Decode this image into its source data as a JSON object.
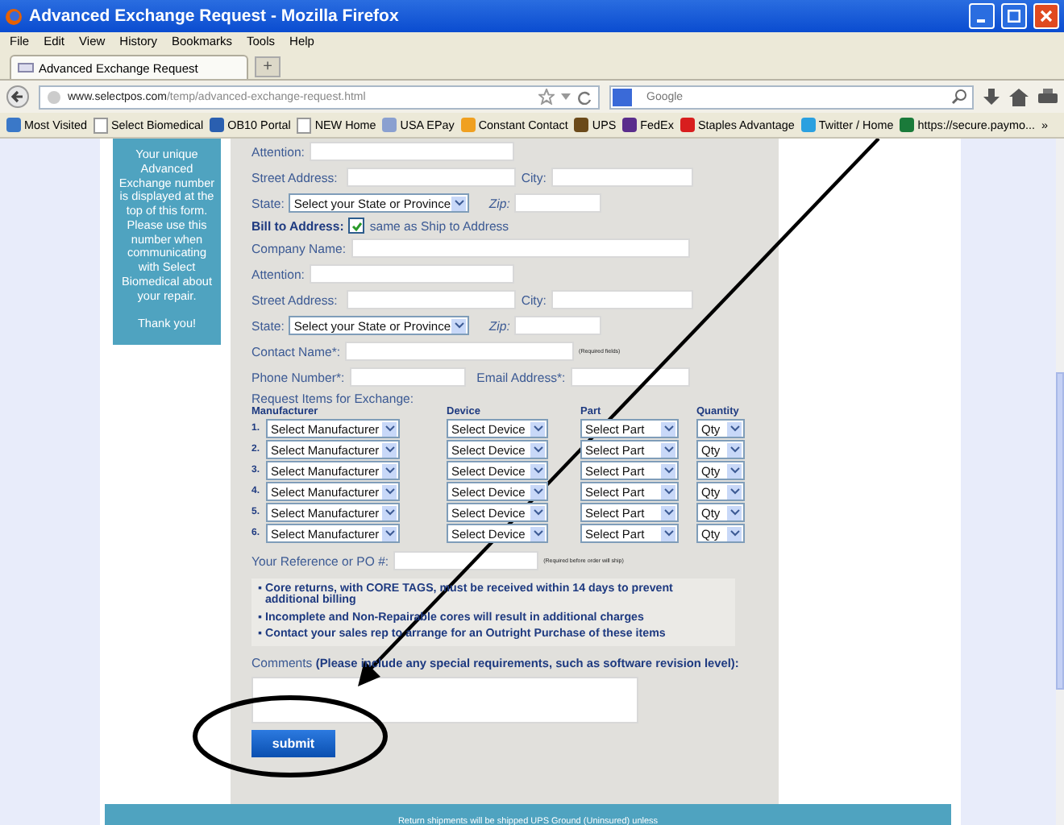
{
  "window": {
    "title": "Advanced Exchange Request - Mozilla Firefox"
  },
  "menu": [
    "File",
    "Edit",
    "View",
    "History",
    "Bookmarks",
    "Tools",
    "Help"
  ],
  "tabs": [
    {
      "label": "Advanced Exchange Request",
      "selected": true
    }
  ],
  "new_tab": "+",
  "address": {
    "host": "www.selectpos.com",
    "path": "/temp/advanced-exchange-request.html"
  },
  "search": {
    "placeholder": "Google"
  },
  "bookmarks": [
    {
      "label": "Most Visited",
      "kind": "favicon",
      "color": "#3a78c8"
    },
    {
      "label": "Select Biomedical",
      "kind": "page"
    },
    {
      "label": "OB10 Portal",
      "kind": "favicon",
      "color": "#2a5fb0"
    },
    {
      "label": "NEW Home",
      "kind": "page"
    },
    {
      "label": "USA EPay",
      "kind": "favicon",
      "color": "#8aa0d0"
    },
    {
      "label": "Constant Contact",
      "kind": "favicon",
      "color": "#f0a020"
    },
    {
      "label": "UPS",
      "kind": "favicon",
      "color": "#6b4a1a"
    },
    {
      "label": "FedEx",
      "kind": "favicon",
      "color": "#5a2d8c"
    },
    {
      "label": "Staples Advantage",
      "kind": "favicon",
      "color": "#d81e1e"
    },
    {
      "label": "Twitter / Home",
      "kind": "favicon",
      "color": "#2aa0e0"
    },
    {
      "label": "https://secure.paymo...",
      "kind": "favicon",
      "color": "#1a7a3a"
    }
  ],
  "bookmarks_more": "»",
  "sidebar": {
    "note": "Your unique Advanced Exchange number is displayed at the top of this form. Please use this number when communicating with Select Biomedical about your repair.",
    "thanks": "Thank you!"
  },
  "ship_rows": [
    {
      "kind": "attention",
      "label": "Attention:"
    },
    {
      "kind": "street",
      "label": "Street Address:",
      "label2": "City:"
    },
    {
      "kind": "state",
      "label": "State:",
      "select": "Select your State or Province",
      "label2": "Zip:"
    }
  ],
  "bill_to": {
    "label": "Bill to Address:",
    "checkbox_label": "same as Ship to Address",
    "checked": true
  },
  "bill_rows": [
    {
      "kind": "company",
      "label": "Company Name:"
    },
    {
      "kind": "attention",
      "label": "Attention:"
    },
    {
      "kind": "street",
      "label": "Street Address:",
      "label2": "City:"
    },
    {
      "kind": "state",
      "label": "State:",
      "select": "Select your State or Province",
      "label2": "Zip:"
    },
    {
      "kind": "contact",
      "label": "Contact Name*:",
      "note": "(Required fields)"
    },
    {
      "kind": "phone",
      "label": "Phone Number*:",
      "label2": "Email Address*:"
    }
  ],
  "items": {
    "title": "Request Items for Exchange:",
    "columns": [
      "Manufacturer",
      "Device",
      "Part",
      "Quantity"
    ],
    "rows": [
      {
        "number": "1.",
        "manufacturer": "Select Manufacturer",
        "device": "Select Device",
        "part": "Select Part",
        "qty": "Qty"
      },
      {
        "number": "2.",
        "manufacturer": "Select Manufacturer",
        "device": "Select Device",
        "part": "Select Part",
        "qty": "Qty"
      },
      {
        "number": "3.",
        "manufacturer": "Select Manufacturer",
        "device": "Select Device",
        "part": "Select Part",
        "qty": "Qty"
      },
      {
        "number": "4.",
        "manufacturer": "Select Manufacturer",
        "device": "Select Device",
        "part": "Select Part",
        "qty": "Qty"
      },
      {
        "number": "5.",
        "manufacturer": "Select Manufacturer",
        "device": "Select Device",
        "part": "Select Part",
        "qty": "Qty"
      },
      {
        "number": "6.",
        "manufacturer": "Select Manufacturer",
        "device": "Select Device",
        "part": "Select Part",
        "qty": "Qty"
      }
    ]
  },
  "reference": {
    "label": "Your Reference or PO #:",
    "note": "(Required before order will ship)"
  },
  "notices": [
    {
      "bullet": "▪",
      "text": "Core returns, with CORE TAGS, must be received within 14 days to prevent additional billing"
    },
    {
      "bullet": "▪",
      "text": "Incomplete and Non-Repairable cores will result in additional charges"
    },
    {
      "bullet": "▪",
      "text": "Contact your sales rep to arrange for an Outright Purchase of these items"
    }
  ],
  "comments": {
    "label": "Comments",
    "hint": "(Please include any special requirements, such as software revision level):"
  },
  "submit": "submit",
  "footer": "Return shipments will be shipped UPS Ground (Uninsured) unless"
}
